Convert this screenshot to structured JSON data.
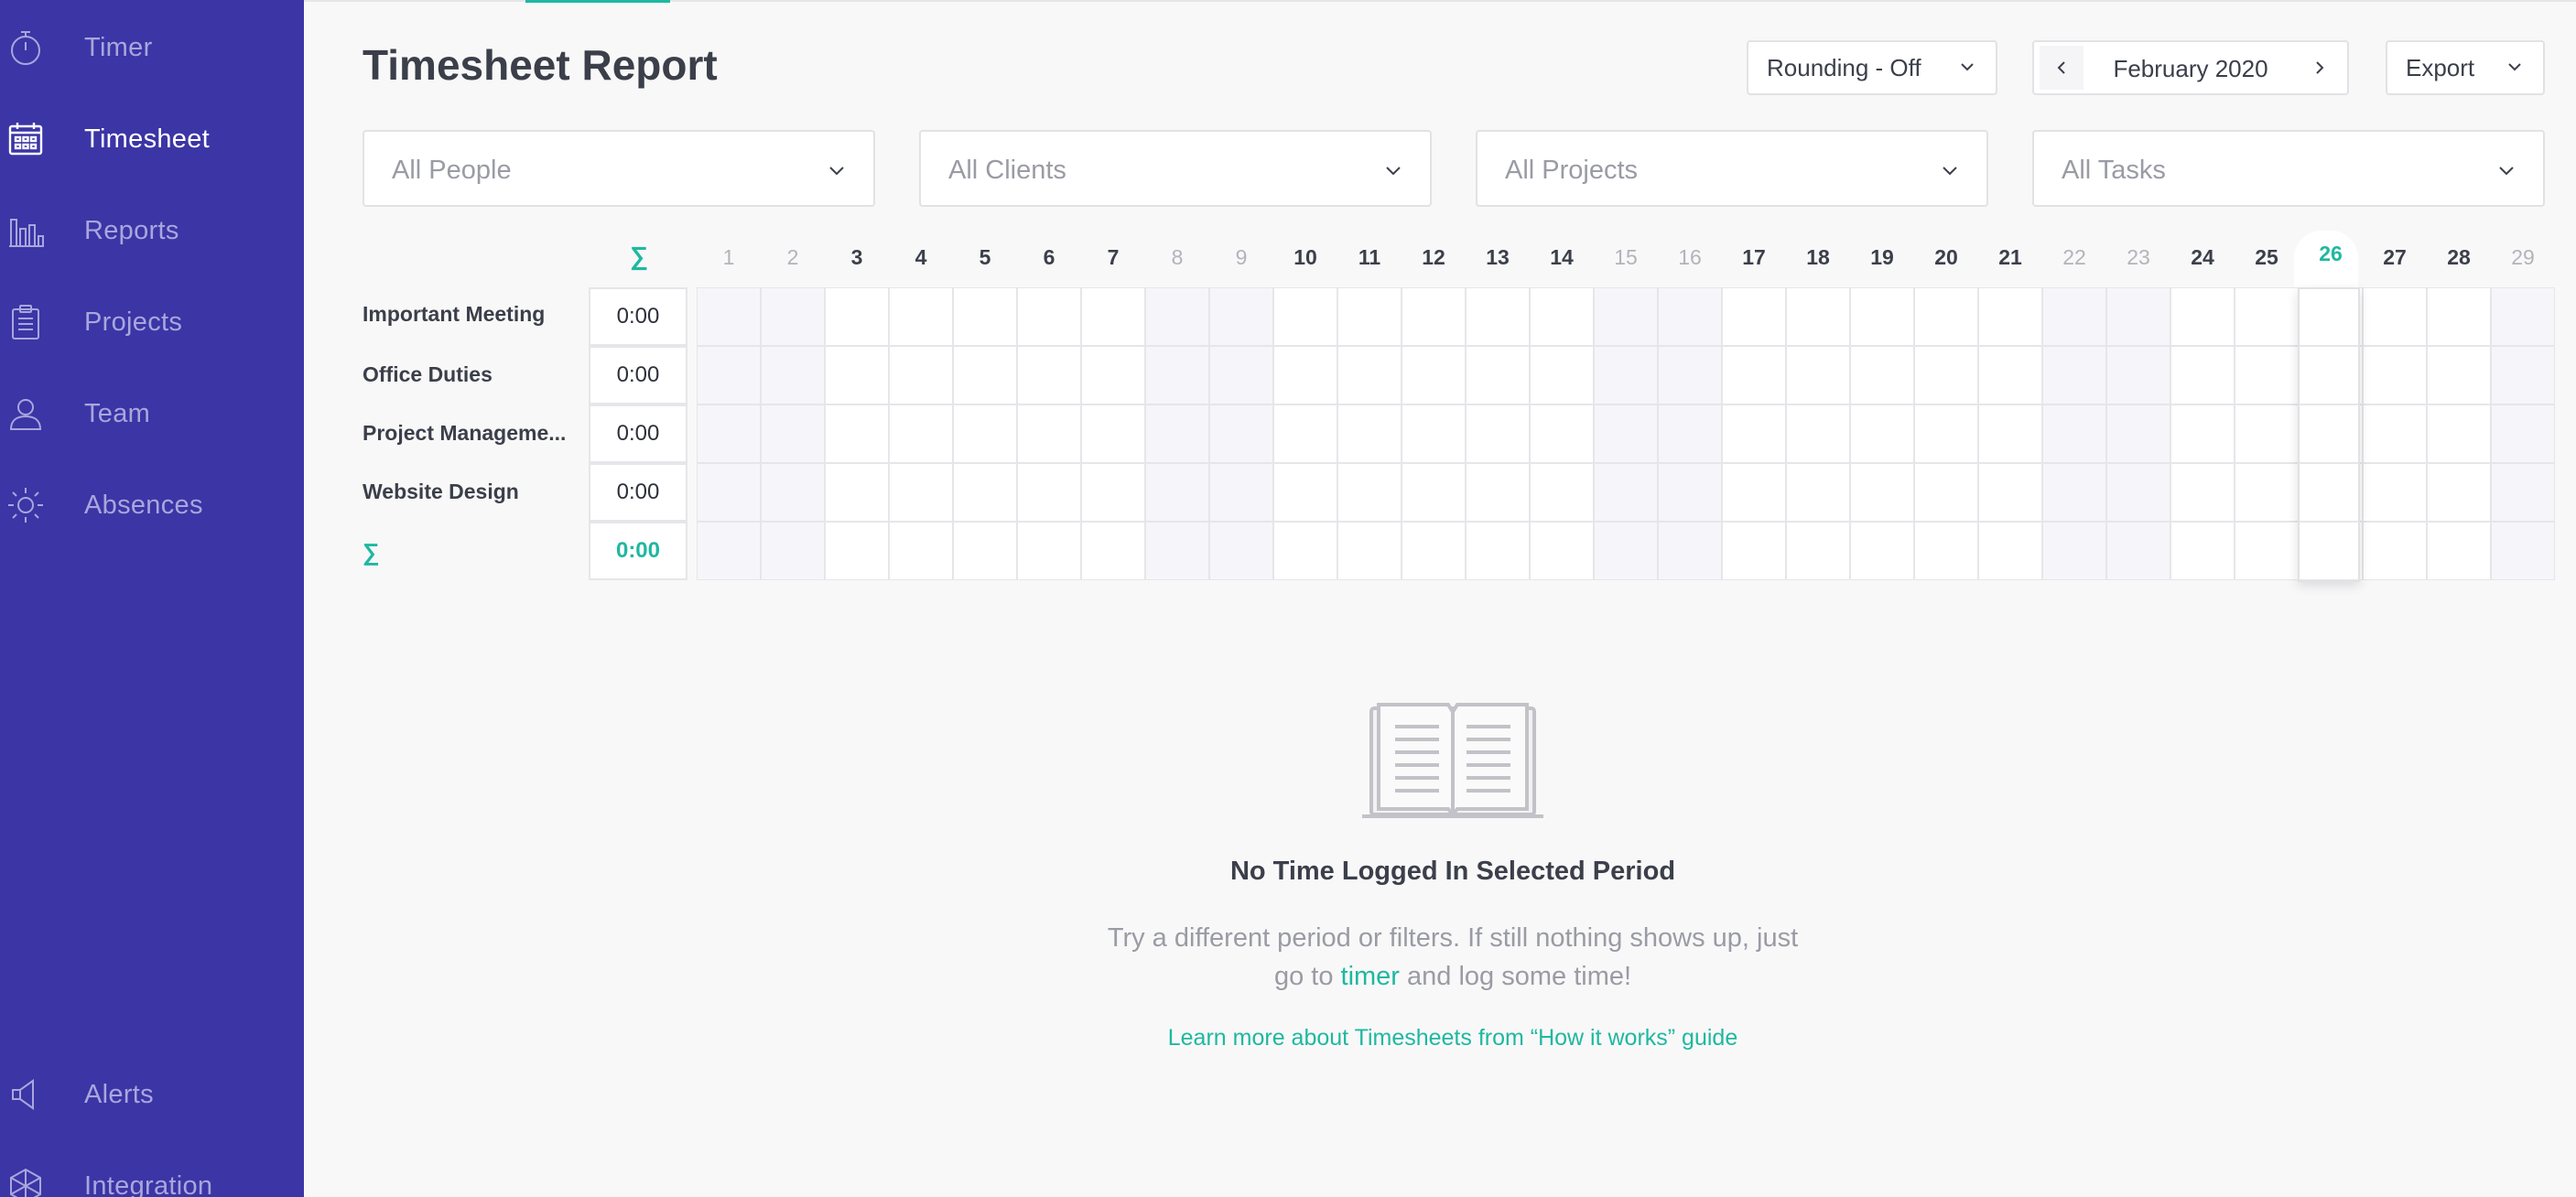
{
  "sidebar": {
    "items": [
      {
        "label": "Timer",
        "icon": "stopwatch-icon",
        "active": false
      },
      {
        "label": "Timesheet",
        "icon": "calendar-icon",
        "active": true
      },
      {
        "label": "Reports",
        "icon": "bar-chart-icon",
        "active": false
      },
      {
        "label": "Projects",
        "icon": "clipboard-icon",
        "active": false
      },
      {
        "label": "Team",
        "icon": "person-icon",
        "active": false
      },
      {
        "label": "Absences",
        "icon": "sun-icon",
        "active": false
      }
    ],
    "bottom_items": [
      {
        "label": "Alerts",
        "icon": "megaphone-icon"
      },
      {
        "label": "Integration",
        "icon": "integration-icon"
      }
    ]
  },
  "header": {
    "title": "Timesheet Report",
    "rounding": "Rounding - Off",
    "period": "February 2020",
    "export": "Export"
  },
  "filters": {
    "people": "All People",
    "clients": "All Clients",
    "projects": "All Projects",
    "tasks": "All Tasks"
  },
  "grid": {
    "sum_symbol": "∑",
    "days": [
      "1",
      "2",
      "3",
      "4",
      "5",
      "6",
      "7",
      "8",
      "9",
      "10",
      "11",
      "12",
      "13",
      "14",
      "15",
      "16",
      "17",
      "18",
      "19",
      "20",
      "21",
      "22",
      "23",
      "24",
      "25",
      "26",
      "27",
      "28",
      "29"
    ],
    "weekend_days": [
      "1",
      "2",
      "8",
      "9",
      "15",
      "16",
      "22",
      "23",
      "29"
    ],
    "today": "26",
    "rows": [
      {
        "label": "Important Meeting",
        "total": "0:00"
      },
      {
        "label": "Office Duties",
        "total": "0:00"
      },
      {
        "label": "Project Manageme...",
        "total": "0:00"
      },
      {
        "label": "Website Design",
        "total": "0:00"
      }
    ],
    "grand_total": "0:00"
  },
  "empty_state": {
    "title": "No Time Logged In Selected Period",
    "text_before": "Try a different period or filters. If still nothing shows up, just go to",
    "link": "timer",
    "text_after": "and log some time!",
    "guide": "Learn more about Timesheets from “How it works” guide"
  },
  "colors": {
    "sidebar_bg": "#3b35a6",
    "accent": "#1fb8a0",
    "weekend_cell": "#f6f5fa"
  }
}
